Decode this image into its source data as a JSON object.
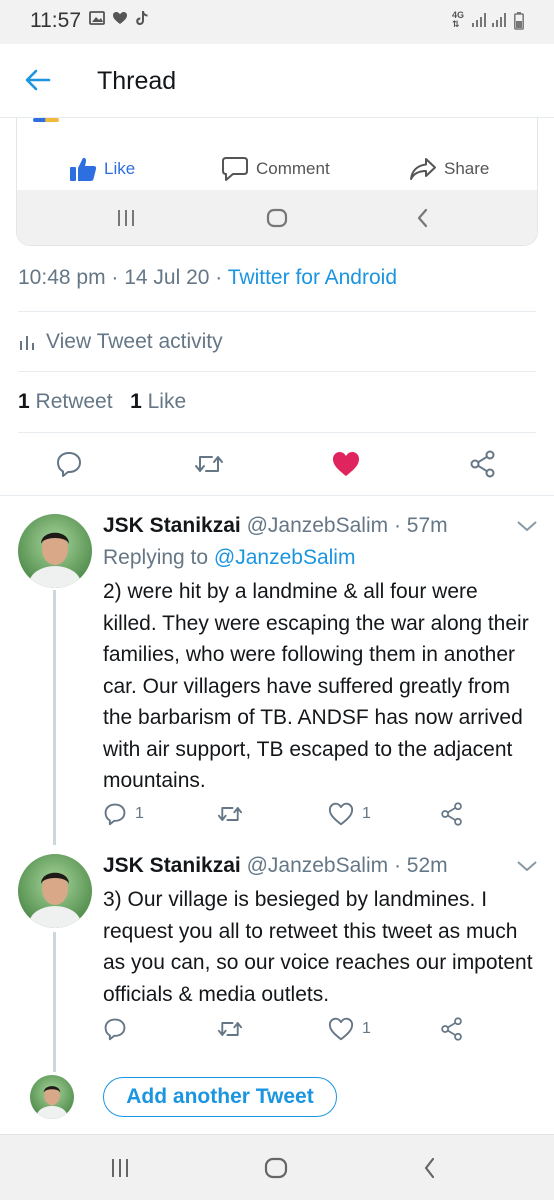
{
  "status_bar": {
    "time": "11:57",
    "network": "4G"
  },
  "header": {
    "title": "Thread"
  },
  "embedded_card": {
    "like_label": "Like",
    "comment_label": "Comment",
    "share_label": "Share"
  },
  "tweet": {
    "time": "10:48 pm",
    "date": "14 Jul 20",
    "source": "Twitter for Android",
    "view_activity": "View Tweet activity",
    "retweet_count": "1",
    "retweet_label": "Retweet",
    "like_count": "1",
    "like_label": "Like"
  },
  "replies": [
    {
      "name": "JSK Stanikzai",
      "handle": "@JanzebSalim",
      "age": "57m",
      "replying_to_label": "Replying to",
      "replying_to_handle": "@JanzebSalim",
      "text": "2) were hit by a landmine & all four were killed. They were escaping the war along their families, who were following them in another car. Our villagers have suffered greatly from the barbarism of TB. ANDSF has now arrived with air support, TB escaped to the adjacent mountains.",
      "reply_count": "1",
      "like_count": "1"
    },
    {
      "name": "JSK Stanikzai",
      "handle": "@JanzebSalim",
      "age": "52m",
      "text": "3) Our village is besieged by landmines. I request you all to retweet this tweet as much as you  can, so our voice reaches our impotent officials & media outlets.",
      "like_count": "1"
    }
  ],
  "compose": {
    "add_label": "Add another Tweet"
  },
  "colors": {
    "accent": "#1b95e0",
    "like_red": "#e0245e",
    "muted": "#657786",
    "fb_blue": "#2d6fe0"
  },
  "icons": [
    "back-arrow-icon",
    "gallery-icon",
    "heart-icon",
    "tiktok-icon",
    "signal-icon",
    "battery-icon",
    "thumbs-up-icon",
    "comment-bubble-icon",
    "share-arrow-icon",
    "recents-icon",
    "home-icon",
    "back-chevron-icon",
    "bar-chart-icon",
    "reply-icon",
    "retweet-icon",
    "like-heart-icon",
    "share-network-icon",
    "chevron-down-icon"
  ]
}
